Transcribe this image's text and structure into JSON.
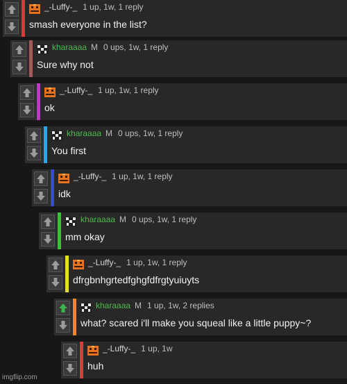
{
  "colors": {
    "green_user": "#4dbb4d",
    "gray_user": "#d6d6d6",
    "vote_active": "#3fb34f",
    "vote_inactive": "#9b9b9b"
  },
  "icons": {
    "upvote": "up-arrow-icon",
    "downvote": "down-arrow-icon"
  },
  "comments": [
    {
      "username": "_-Luffy-_",
      "mod": "",
      "stats": "1 up, 1w, 1 reply",
      "text": "smash everyone in the list?",
      "bar": "#d93b3b",
      "avatar": "luffy",
      "user_color": "#d6d6d6",
      "upvoted": false
    },
    {
      "username": "kharaaaa",
      "mod": "M",
      "stats": "0 ups, 1w, 1 reply",
      "text": "Sure why not",
      "bar": "#a55a5a",
      "avatar": "khara",
      "user_color": "#4dbb4d",
      "upvoted": false
    },
    {
      "username": "_-Luffy-_",
      "mod": "",
      "stats": "1 up, 1w, 1 reply",
      "text": "ok",
      "bar": "#b63cc4",
      "avatar": "luffy",
      "user_color": "#d6d6d6",
      "upvoted": false
    },
    {
      "username": "kharaaaa",
      "mod": "M",
      "stats": "0 ups, 1w, 1 reply",
      "text": "You first",
      "bar": "#2fa4e7",
      "avatar": "khara",
      "user_color": "#4dbb4d",
      "upvoted": false
    },
    {
      "username": "_-Luffy-_",
      "mod": "",
      "stats": "1 up, 1w, 1 reply",
      "text": "idk",
      "bar": "#3a48d8",
      "avatar": "luffy",
      "user_color": "#d6d6d6",
      "upvoted": false
    },
    {
      "username": "kharaaaa",
      "mod": "M",
      "stats": "0 ups, 1w, 1 reply",
      "text": "mm okay",
      "bar": "#37c437",
      "avatar": "khara",
      "user_color": "#4dbb4d",
      "upvoted": false
    },
    {
      "username": "_-Luffy-_",
      "mod": "",
      "stats": "1 up, 1w, 1 reply",
      "text": "dfrgbnhgrtedfghgfdfrgtyuiuyts",
      "bar": "#e4e02a",
      "avatar": "luffy",
      "user_color": "#d6d6d6",
      "upvoted": false
    },
    {
      "username": "kharaaaa",
      "mod": "M",
      "stats": "1 up, 1w, 2 replies",
      "text": "what? scared i'll make you squeal like a little puppy~?",
      "bar": "#f08a1c",
      "avatar": "khara",
      "user_color": "#4dbb4d",
      "upvoted": true
    },
    {
      "username": "_-Luffy-_",
      "mod": "",
      "stats": "1 up, 1w",
      "text": "huh",
      "bar": "#e03a3a",
      "avatar": "luffy",
      "user_color": "#d6d6d6",
      "upvoted": false
    }
  ],
  "watermark": "imgflip.com"
}
